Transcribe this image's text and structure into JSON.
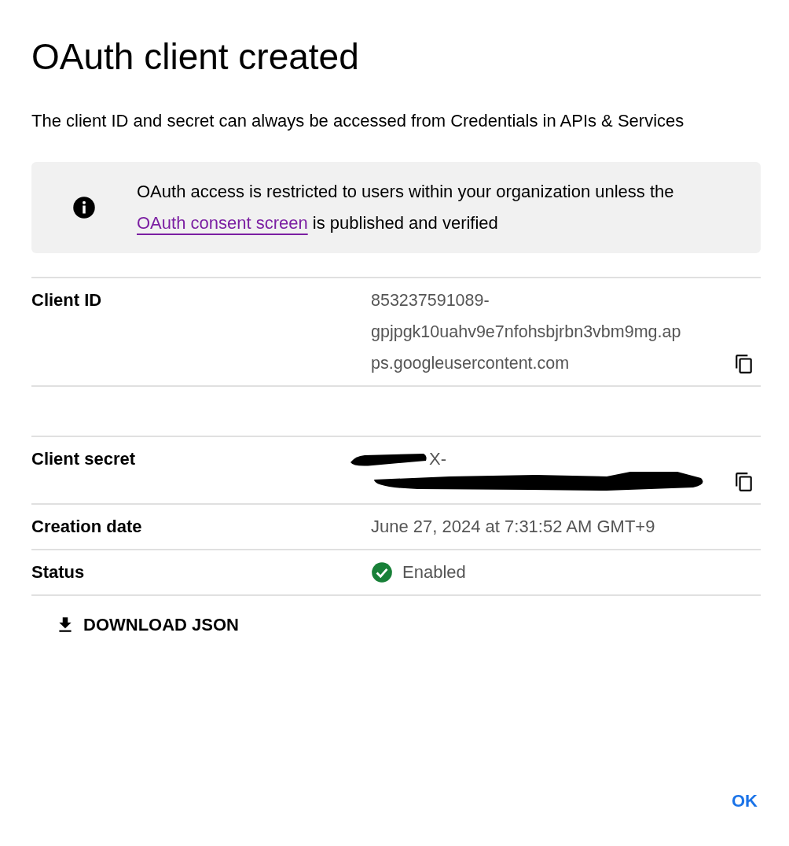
{
  "dialog": {
    "title": "OAuth client created",
    "description": "The client ID and secret can always be accessed from Credentials in APIs & Services",
    "notice": {
      "before": "OAuth access is restricted to users within your organization unless the ",
      "link": "OAuth consent screen",
      "after": " is published and verified"
    },
    "details": [
      {
        "kind": "copyable",
        "label": "Client ID",
        "lines": [
          "853237591089-",
          "gpjpgk10uahv9e7nfohsbjrbn3vbm9mg.ap",
          "ps.googleusercontent.com"
        ]
      },
      {
        "kind": "spacer"
      },
      {
        "kind": "redacted",
        "label": "Client secret",
        "lines": [
          "X-"
        ]
      },
      {
        "kind": "text",
        "label": "Creation date",
        "lines": [
          "June 27, 2024 at 7:31:52 AM GMT+9"
        ]
      },
      {
        "kind": "status",
        "label": "Status",
        "lines": [
          "Enabled"
        ],
        "enabled": true
      }
    ],
    "download_button": "DOWNLOAD JSON",
    "ok_button": "OK"
  }
}
